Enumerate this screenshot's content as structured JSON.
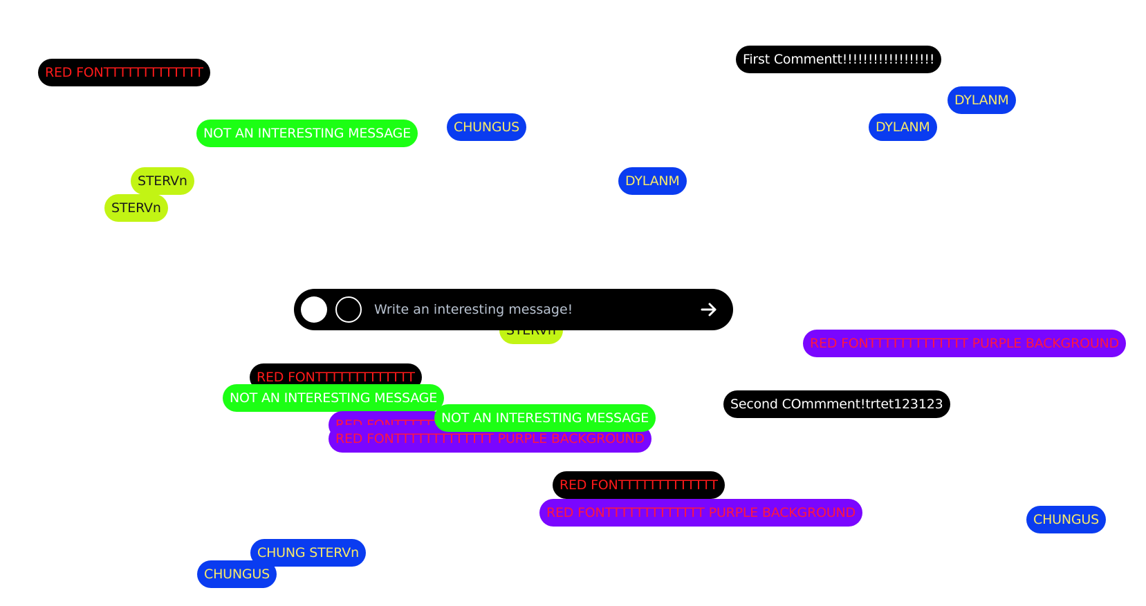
{
  "comments": [
    {
      "text": "RED FONTTTTTTTTTTTTT",
      "style": "black-red"
    },
    {
      "text": "First Commentt!!!!!!!!!!!!!!!!!!",
      "style": "black"
    },
    {
      "text": "DYLANM",
      "style": "blue"
    },
    {
      "text": "NOT AN INTERESTING MESSAGE",
      "style": "green"
    },
    {
      "text": "CHUNGUS",
      "style": "blue"
    },
    {
      "text": "DYLANM",
      "style": "blue"
    },
    {
      "text": "STERVn",
      "style": "lime"
    },
    {
      "text": "DYLANM",
      "style": "blue"
    },
    {
      "text": "STERVn",
      "style": "lime"
    },
    {
      "text": "STERVn",
      "style": "lime"
    },
    {
      "text": "RED FONTTTTTTTTTTTTT PURPLE BACKGROUND",
      "style": "purple"
    },
    {
      "text": "RED FONTTTTTTTTTTTTT",
      "style": "black-red"
    },
    {
      "text": "NOT AN INTERESTING MESSAGE",
      "style": "green"
    },
    {
      "text": "Second COmmment!trtet123123",
      "style": "black"
    },
    {
      "text": "RED FONTTTTTTTTTTTTT",
      "style": "purple"
    },
    {
      "text": "RED FONTTTTTTTTTTTTT PURPLE BACKGROUND",
      "style": "purple"
    },
    {
      "text": "NOT AN INTERESTING MESSAGE",
      "style": "green"
    },
    {
      "text": "RED FONTTTTTTTTTTTTT",
      "style": "black-red"
    },
    {
      "text": "RED FONTTTTTTTTTTTTT PURPLE BACKGROUND",
      "style": "purple"
    },
    {
      "text": "CHUNGUS",
      "style": "blue"
    },
    {
      "text": "CHUNG  STERVn",
      "style": "blue"
    },
    {
      "text": "CHUNGUS",
      "style": "blue"
    }
  ],
  "composer": {
    "placeholder": "Write an interesting message!",
    "color_options": [
      "white-swatch",
      "black-swatch"
    ],
    "send_icon": "arrow-right-icon"
  },
  "colors": {
    "black": "#000000",
    "red_text": "#ff1a1a",
    "blue": "#0a3cf0",
    "yellow_text": "#f7e96a",
    "green": "#1cff14",
    "lime": "#c2f414",
    "purple": "#7a06ff",
    "purple_text": "#ff1640"
  }
}
